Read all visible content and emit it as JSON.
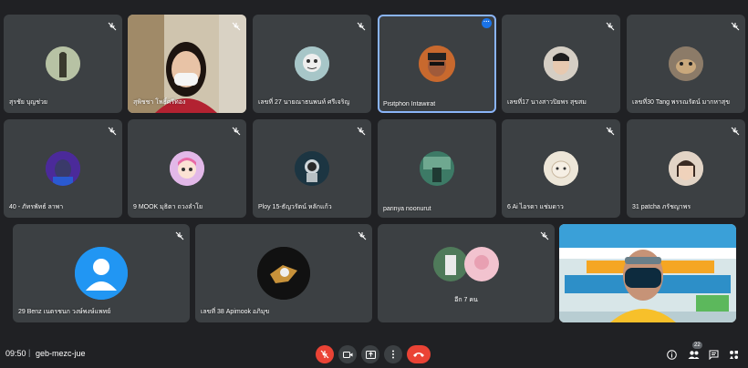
{
  "participants": [
    {
      "name": "สุรชัย บุญช่วย",
      "type": "avatar",
      "color": "#8a8f7a"
    },
    {
      "name": "สุพิชชา โพธิ์ศรีทอง",
      "type": "video"
    },
    {
      "name": "เลขที่ 27 นายณาธนพนท์ ศรีเจริญ",
      "type": "avatar",
      "color": "#9fb8b9"
    },
    {
      "name": "Pisitphon Intawirat",
      "type": "avatar",
      "color": "#b35a2b",
      "active": true
    },
    {
      "name": "เลขที่17 นางสาวปิยพร สุขสม",
      "type": "avatar",
      "color": "#c9c2b8"
    },
    {
      "name": "เลขที่30 Tang พรรณรัตน์ มากหาสุข",
      "type": "avatar",
      "color": "#7a6a5a"
    },
    {
      "name": "40 - ภัทรพัทธ์ ลาพา",
      "type": "avatar",
      "color": "#5a2ca8"
    },
    {
      "name": "9 MOOK มุธิตา ถวงลำโย",
      "type": "avatar",
      "color": "#d7a8e0"
    },
    {
      "name": "Ploy 15-ธัญวรัตน์ หลักแก้ว",
      "type": "avatar",
      "color": "#1f3b4a"
    },
    {
      "name": "parinya noonurut",
      "type": "avatar",
      "color": "#2e6b5a"
    },
    {
      "name": "6 Ai ไอรดา แช่มดาว",
      "type": "avatar",
      "color": "#e8e0d0"
    },
    {
      "name": "31 patcha ภรัชญาพร",
      "type": "avatar",
      "color": "#d9c6b5"
    },
    {
      "name": "29 Benz เนตรชนก วงษ์พงษ์แพทย์",
      "type": "default"
    },
    {
      "name": "เลขที่ 38 Apimook อภิมุข",
      "type": "avatar",
      "color": "#1a1a1a"
    },
    {
      "name": "อีก 7 คน",
      "type": "others"
    },
    {
      "name": "",
      "type": "video-presenter"
    }
  ],
  "bottom": {
    "time": "09:50",
    "separator": "|",
    "meeting_code": "geb-mezc-jue",
    "people_count": "22"
  },
  "colors": {
    "background": "#202124",
    "tile": "#3c4043",
    "active_outline": "#8ab4f8",
    "danger": "#ea4335"
  }
}
